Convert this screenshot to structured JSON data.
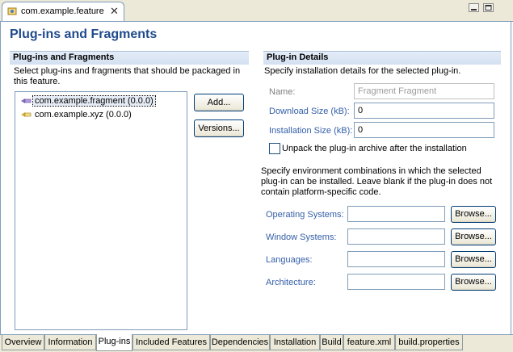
{
  "editor": {
    "tab_title": "com.example.feature",
    "page_title": "Plug-ins and Fragments"
  },
  "left_section": {
    "title": "Plug-ins and Fragments",
    "description": "Select plug-ins and fragments that should be packaged in this feature.",
    "items": [
      {
        "label": "com.example.fragment (0.0.0)",
        "icon": "fragment-icon",
        "selected": true
      },
      {
        "label": "com.example.xyz (0.0.0)",
        "icon": "plugin-icon",
        "selected": false
      }
    ],
    "add_label": "Add...",
    "versions_label": "Versions..."
  },
  "right_section": {
    "title": "Plug-in Details",
    "description": "Specify installation details for the selected plug-in.",
    "name_label": "Name:",
    "name_value": "Fragment Fragment",
    "download_label": "Download Size (kB):",
    "download_value": "0",
    "install_label": "Installation Size (kB):",
    "install_value": "0",
    "unpack_label": "Unpack the plug-in archive after the installation",
    "unpack_checked": false,
    "env_description": "Specify environment combinations in which the selected plug-in can be installed. Leave blank if the plug-in does not contain platform-specific code.",
    "env_rows": [
      {
        "label": "Operating Systems:",
        "value": "",
        "button": "Browse..."
      },
      {
        "label": "Window Systems:",
        "value": "",
        "button": "Browse..."
      },
      {
        "label": "Languages:",
        "value": "",
        "button": "Browse..."
      },
      {
        "label": "Architecture:",
        "value": "",
        "button": "Browse..."
      }
    ]
  },
  "bottom_tabs": [
    {
      "label": "Overview",
      "active": false
    },
    {
      "label": "Information",
      "active": false
    },
    {
      "label": "Plug-ins",
      "active": true
    },
    {
      "label": "Included Features",
      "active": false
    },
    {
      "label": "Dependencies",
      "active": false
    },
    {
      "label": "Installation",
      "active": false
    },
    {
      "label": "Build",
      "active": false
    },
    {
      "label": "feature.xml",
      "active": false
    },
    {
      "label": "build.properties",
      "active": false
    }
  ],
  "colors": {
    "section_title": "#000000",
    "page_title": "#1f4a8c",
    "field_label": "#335ea8"
  }
}
